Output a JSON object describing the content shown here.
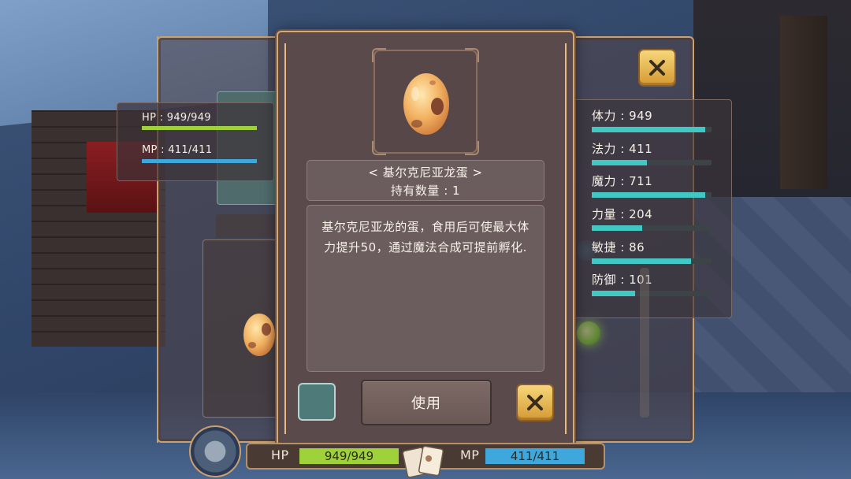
{
  "colors": {
    "hp_green": "#9fd13a",
    "mp_blue": "#3ea8dc",
    "stat_teal": "#41c8c4",
    "frame_gold": "#d6a872",
    "close_yellow": "#f2c95c"
  },
  "character": {
    "hp_label": "HP : 949/949",
    "mp_label": "MP : 411/411",
    "hp_fraction": 1.0,
    "mp_fraction": 1.0
  },
  "stats": [
    {
      "label": "体力 : 949",
      "fraction": 0.95
    },
    {
      "label": "法力 : 411",
      "fraction": 0.46
    },
    {
      "label": "魔力 : 711",
      "fraction": 0.95
    },
    {
      "label": "力量 : 204",
      "fraction": 0.42
    },
    {
      "label": "敏捷 : 86",
      "fraction": 0.83
    },
    {
      "label": "防御 : 101",
      "fraction": 0.36
    }
  ],
  "item_detail": {
    "name": "< 基尔克尼亚龙蛋 >",
    "quantity": "持有数量 : 1",
    "description": "基尔克尼亚龙的蛋，食用后可使最大体力提升50，通过魔法合成可提前孵化.",
    "use_button": "使用",
    "icon": "dragon-egg-icon"
  },
  "icons": {
    "close": "close-icon",
    "settings": "gear-icon",
    "cards": "cards-icon"
  },
  "hud": {
    "hp_label": "HP",
    "hp_value": "949/949",
    "mp_label": "MP",
    "mp_value": "411/411",
    "hp_fraction": 1.0,
    "mp_fraction": 1.0
  }
}
